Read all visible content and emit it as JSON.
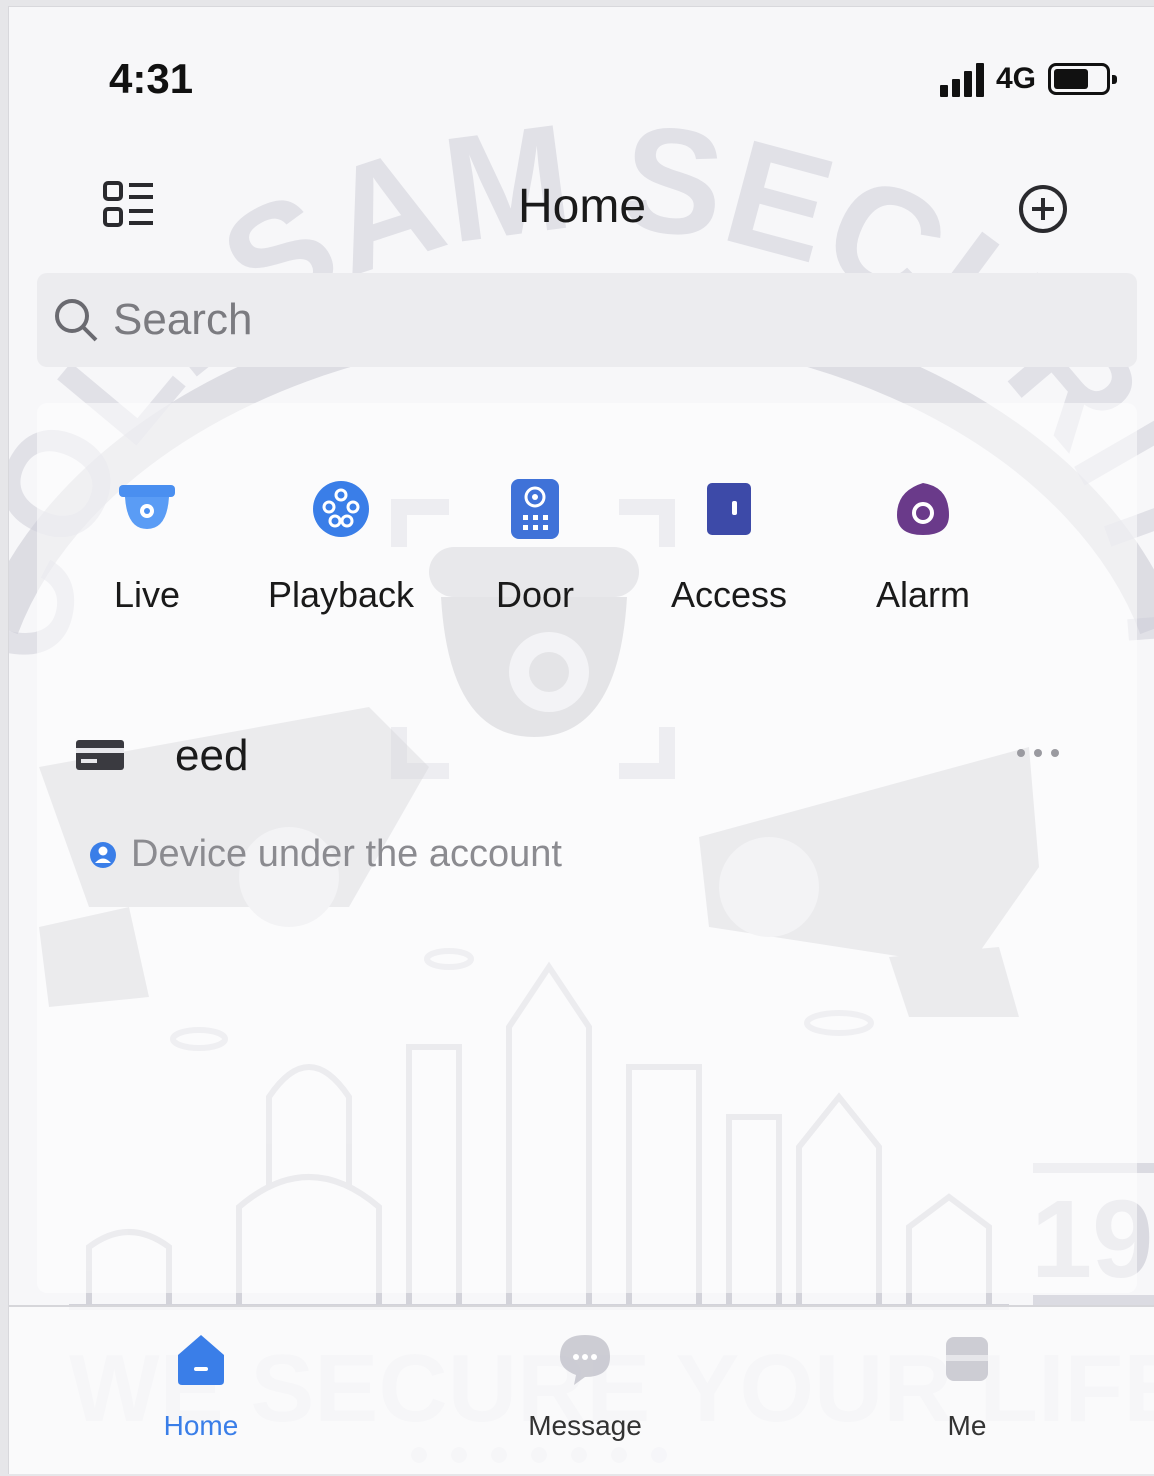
{
  "status_bar": {
    "time": "4:31",
    "network": "4G"
  },
  "header": {
    "title": "Home"
  },
  "search": {
    "placeholder": "Search"
  },
  "shortcuts": [
    {
      "label": "Live",
      "icon": "dome-camera-icon",
      "color": "#4a8ff0"
    },
    {
      "label": "Playback",
      "icon": "playback-reel-icon",
      "color": "#3a7ee8"
    },
    {
      "label": "Door",
      "icon": "door-intercom-icon",
      "color": "#3f72d8"
    },
    {
      "label": "Access",
      "icon": "access-panel-icon",
      "color": "#3d4aa8"
    },
    {
      "label": "Alarm",
      "icon": "alarm-sensor-icon",
      "color": "#6a3a8a"
    }
  ],
  "device": {
    "name": "eed",
    "icon": "recorder-device-icon",
    "account_note": "Device under the account"
  },
  "tabbar": {
    "items": [
      {
        "label": "Home",
        "icon": "home-icon",
        "active": true
      },
      {
        "label": "Message",
        "icon": "message-icon",
        "active": false
      },
      {
        "label": "Me",
        "icon": "profile-icon",
        "active": false
      }
    ]
  },
  "watermark": {
    "arc_text": "COLLSAM SECURITY",
    "slogan": "WE SECURE YOUR LIFE",
    "year_fragment": "19"
  },
  "colors": {
    "accent": "#3a7ee8",
    "background": "#f7f7f9"
  }
}
